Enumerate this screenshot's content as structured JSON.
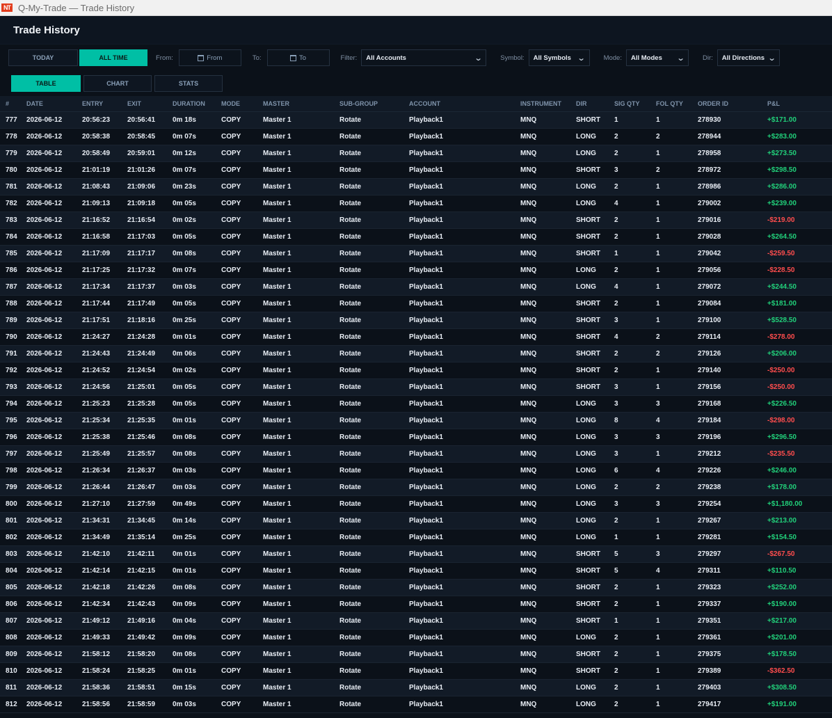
{
  "window": {
    "title": "Q-My-Trade — Trade History",
    "logo_text": "NT"
  },
  "header": {
    "title": "Trade History"
  },
  "toolbar": {
    "today": "TODAY",
    "all_time": "ALL TIME",
    "from_label": "From:",
    "from_placeholder": "From",
    "to_label": "To:",
    "to_placeholder": "To",
    "filter_label": "Filter:",
    "filter_value": "All Accounts",
    "symbol_label": "Symbol:",
    "symbol_value": "All Symbols",
    "mode_label": "Mode:",
    "mode_value": "All Modes",
    "dir_label": "Dir:",
    "dir_value": "All Directions"
  },
  "views": {
    "table": "TABLE",
    "chart": "CHART",
    "stats": "STATS",
    "active": "TABLE"
  },
  "colors": {
    "accent": "#00bfa5",
    "positive": "#21d07a",
    "negative": "#ff4d4d"
  },
  "table": {
    "columns": [
      "#",
      "DATE",
      "ENTRY",
      "EXIT",
      "DURATION",
      "MODE",
      "MASTER",
      "SUB-GROUP",
      "ACCOUNT",
      "INSTRUMENT",
      "DIR",
      "SIG QTY",
      "FOL QTY",
      "ORDER ID",
      "P&L"
    ],
    "rows": [
      [
        "777",
        "2026-06-12",
        "20:56:23",
        "20:56:41",
        "0m 18s",
        "COPY",
        "Master 1",
        "Rotate",
        "Playback1",
        "MNQ",
        "SHORT",
        "1",
        "1",
        "278930",
        "+$171.00"
      ],
      [
        "778",
        "2026-06-12",
        "20:58:38",
        "20:58:45",
        "0m 07s",
        "COPY",
        "Master 1",
        "Rotate",
        "Playback1",
        "MNQ",
        "LONG",
        "2",
        "2",
        "278944",
        "+$283.00"
      ],
      [
        "779",
        "2026-06-12",
        "20:58:49",
        "20:59:01",
        "0m 12s",
        "COPY",
        "Master 1",
        "Rotate",
        "Playback1",
        "MNQ",
        "LONG",
        "2",
        "1",
        "278958",
        "+$273.50"
      ],
      [
        "780",
        "2026-06-12",
        "21:01:19",
        "21:01:26",
        "0m 07s",
        "COPY",
        "Master 1",
        "Rotate",
        "Playback1",
        "MNQ",
        "SHORT",
        "3",
        "2",
        "278972",
        "+$298.50"
      ],
      [
        "781",
        "2026-06-12",
        "21:08:43",
        "21:09:06",
        "0m 23s",
        "COPY",
        "Master 1",
        "Rotate",
        "Playback1",
        "MNQ",
        "LONG",
        "2",
        "1",
        "278986",
        "+$286.00"
      ],
      [
        "782",
        "2026-06-12",
        "21:09:13",
        "21:09:18",
        "0m 05s",
        "COPY",
        "Master 1",
        "Rotate",
        "Playback1",
        "MNQ",
        "LONG",
        "4",
        "1",
        "279002",
        "+$239.00"
      ],
      [
        "783",
        "2026-06-12",
        "21:16:52",
        "21:16:54",
        "0m 02s",
        "COPY",
        "Master 1",
        "Rotate",
        "Playback1",
        "MNQ",
        "SHORT",
        "2",
        "1",
        "279016",
        "-$219.00"
      ],
      [
        "784",
        "2026-06-12",
        "21:16:58",
        "21:17:03",
        "0m 05s",
        "COPY",
        "Master 1",
        "Rotate",
        "Playback1",
        "MNQ",
        "SHORT",
        "2",
        "1",
        "279028",
        "+$264.50"
      ],
      [
        "785",
        "2026-06-12",
        "21:17:09",
        "21:17:17",
        "0m 08s",
        "COPY",
        "Master 1",
        "Rotate",
        "Playback1",
        "MNQ",
        "SHORT",
        "1",
        "1",
        "279042",
        "-$259.50"
      ],
      [
        "786",
        "2026-06-12",
        "21:17:25",
        "21:17:32",
        "0m 07s",
        "COPY",
        "Master 1",
        "Rotate",
        "Playback1",
        "MNQ",
        "LONG",
        "2",
        "1",
        "279056",
        "-$228.50"
      ],
      [
        "787",
        "2026-06-12",
        "21:17:34",
        "21:17:37",
        "0m 03s",
        "COPY",
        "Master 1",
        "Rotate",
        "Playback1",
        "MNQ",
        "LONG",
        "4",
        "1",
        "279072",
        "+$244.50"
      ],
      [
        "788",
        "2026-06-12",
        "21:17:44",
        "21:17:49",
        "0m 05s",
        "COPY",
        "Master 1",
        "Rotate",
        "Playback1",
        "MNQ",
        "SHORT",
        "2",
        "1",
        "279084",
        "+$181.00"
      ],
      [
        "789",
        "2026-06-12",
        "21:17:51",
        "21:18:16",
        "0m 25s",
        "COPY",
        "Master 1",
        "Rotate",
        "Playback1",
        "MNQ",
        "SHORT",
        "3",
        "1",
        "279100",
        "+$528.50"
      ],
      [
        "790",
        "2026-06-12",
        "21:24:27",
        "21:24:28",
        "0m 01s",
        "COPY",
        "Master 1",
        "Rotate",
        "Playback1",
        "MNQ",
        "SHORT",
        "4",
        "2",
        "279114",
        "-$278.00"
      ],
      [
        "791",
        "2026-06-12",
        "21:24:43",
        "21:24:49",
        "0m 06s",
        "COPY",
        "Master 1",
        "Rotate",
        "Playback1",
        "MNQ",
        "SHORT",
        "2",
        "2",
        "279126",
        "+$206.00"
      ],
      [
        "792",
        "2026-06-12",
        "21:24:52",
        "21:24:54",
        "0m 02s",
        "COPY",
        "Master 1",
        "Rotate",
        "Playback1",
        "MNQ",
        "SHORT",
        "2",
        "1",
        "279140",
        "-$250.00"
      ],
      [
        "793",
        "2026-06-12",
        "21:24:56",
        "21:25:01",
        "0m 05s",
        "COPY",
        "Master 1",
        "Rotate",
        "Playback1",
        "MNQ",
        "SHORT",
        "3",
        "1",
        "279156",
        "-$250.00"
      ],
      [
        "794",
        "2026-06-12",
        "21:25:23",
        "21:25:28",
        "0m 05s",
        "COPY",
        "Master 1",
        "Rotate",
        "Playback1",
        "MNQ",
        "LONG",
        "3",
        "3",
        "279168",
        "+$226.50"
      ],
      [
        "795",
        "2026-06-12",
        "21:25:34",
        "21:25:35",
        "0m 01s",
        "COPY",
        "Master 1",
        "Rotate",
        "Playback1",
        "MNQ",
        "LONG",
        "8",
        "4",
        "279184",
        "-$298.00"
      ],
      [
        "796",
        "2026-06-12",
        "21:25:38",
        "21:25:46",
        "0m 08s",
        "COPY",
        "Master 1",
        "Rotate",
        "Playback1",
        "MNQ",
        "LONG",
        "3",
        "3",
        "279196",
        "+$296.50"
      ],
      [
        "797",
        "2026-06-12",
        "21:25:49",
        "21:25:57",
        "0m 08s",
        "COPY",
        "Master 1",
        "Rotate",
        "Playback1",
        "MNQ",
        "LONG",
        "3",
        "1",
        "279212",
        "-$235.50"
      ],
      [
        "798",
        "2026-06-12",
        "21:26:34",
        "21:26:37",
        "0m 03s",
        "COPY",
        "Master 1",
        "Rotate",
        "Playback1",
        "MNQ",
        "LONG",
        "6",
        "4",
        "279226",
        "+$246.00"
      ],
      [
        "799",
        "2026-06-12",
        "21:26:44",
        "21:26:47",
        "0m 03s",
        "COPY",
        "Master 1",
        "Rotate",
        "Playback1",
        "MNQ",
        "LONG",
        "2",
        "2",
        "279238",
        "+$178.00"
      ],
      [
        "800",
        "2026-06-12",
        "21:27:10",
        "21:27:59",
        "0m 49s",
        "COPY",
        "Master 1",
        "Rotate",
        "Playback1",
        "MNQ",
        "LONG",
        "3",
        "3",
        "279254",
        "+$1,180.00"
      ],
      [
        "801",
        "2026-06-12",
        "21:34:31",
        "21:34:45",
        "0m 14s",
        "COPY",
        "Master 1",
        "Rotate",
        "Playback1",
        "MNQ",
        "LONG",
        "2",
        "1",
        "279267",
        "+$213.00"
      ],
      [
        "802",
        "2026-06-12",
        "21:34:49",
        "21:35:14",
        "0m 25s",
        "COPY",
        "Master 1",
        "Rotate",
        "Playback1",
        "MNQ",
        "LONG",
        "1",
        "1",
        "279281",
        "+$154.50"
      ],
      [
        "803",
        "2026-06-12",
        "21:42:10",
        "21:42:11",
        "0m 01s",
        "COPY",
        "Master 1",
        "Rotate",
        "Playback1",
        "MNQ",
        "SHORT",
        "5",
        "3",
        "279297",
        "-$267.50"
      ],
      [
        "804",
        "2026-06-12",
        "21:42:14",
        "21:42:15",
        "0m 01s",
        "COPY",
        "Master 1",
        "Rotate",
        "Playback1",
        "MNQ",
        "SHORT",
        "5",
        "4",
        "279311",
        "+$110.50"
      ],
      [
        "805",
        "2026-06-12",
        "21:42:18",
        "21:42:26",
        "0m 08s",
        "COPY",
        "Master 1",
        "Rotate",
        "Playback1",
        "MNQ",
        "SHORT",
        "2",
        "1",
        "279323",
        "+$252.00"
      ],
      [
        "806",
        "2026-06-12",
        "21:42:34",
        "21:42:43",
        "0m 09s",
        "COPY",
        "Master 1",
        "Rotate",
        "Playback1",
        "MNQ",
        "SHORT",
        "2",
        "1",
        "279337",
        "+$190.00"
      ],
      [
        "807",
        "2026-06-12",
        "21:49:12",
        "21:49:16",
        "0m 04s",
        "COPY",
        "Master 1",
        "Rotate",
        "Playback1",
        "MNQ",
        "SHORT",
        "1",
        "1",
        "279351",
        "+$217.00"
      ],
      [
        "808",
        "2026-06-12",
        "21:49:33",
        "21:49:42",
        "0m 09s",
        "COPY",
        "Master 1",
        "Rotate",
        "Playback1",
        "MNQ",
        "LONG",
        "2",
        "1",
        "279361",
        "+$201.00"
      ],
      [
        "809",
        "2026-06-12",
        "21:58:12",
        "21:58:20",
        "0m 08s",
        "COPY",
        "Master 1",
        "Rotate",
        "Playback1",
        "MNQ",
        "SHORT",
        "2",
        "1",
        "279375",
        "+$178.50"
      ],
      [
        "810",
        "2026-06-12",
        "21:58:24",
        "21:58:25",
        "0m 01s",
        "COPY",
        "Master 1",
        "Rotate",
        "Playback1",
        "MNQ",
        "SHORT",
        "2",
        "1",
        "279389",
        "-$362.50"
      ],
      [
        "811",
        "2026-06-12",
        "21:58:36",
        "21:58:51",
        "0m 15s",
        "COPY",
        "Master 1",
        "Rotate",
        "Playback1",
        "MNQ",
        "LONG",
        "2",
        "1",
        "279403",
        "+$308.50"
      ],
      [
        "812",
        "2026-06-12",
        "21:58:56",
        "21:58:59",
        "0m 03s",
        "COPY",
        "Master 1",
        "Rotate",
        "Playback1",
        "MNQ",
        "LONG",
        "2",
        "1",
        "279417",
        "+$191.00"
      ]
    ]
  }
}
